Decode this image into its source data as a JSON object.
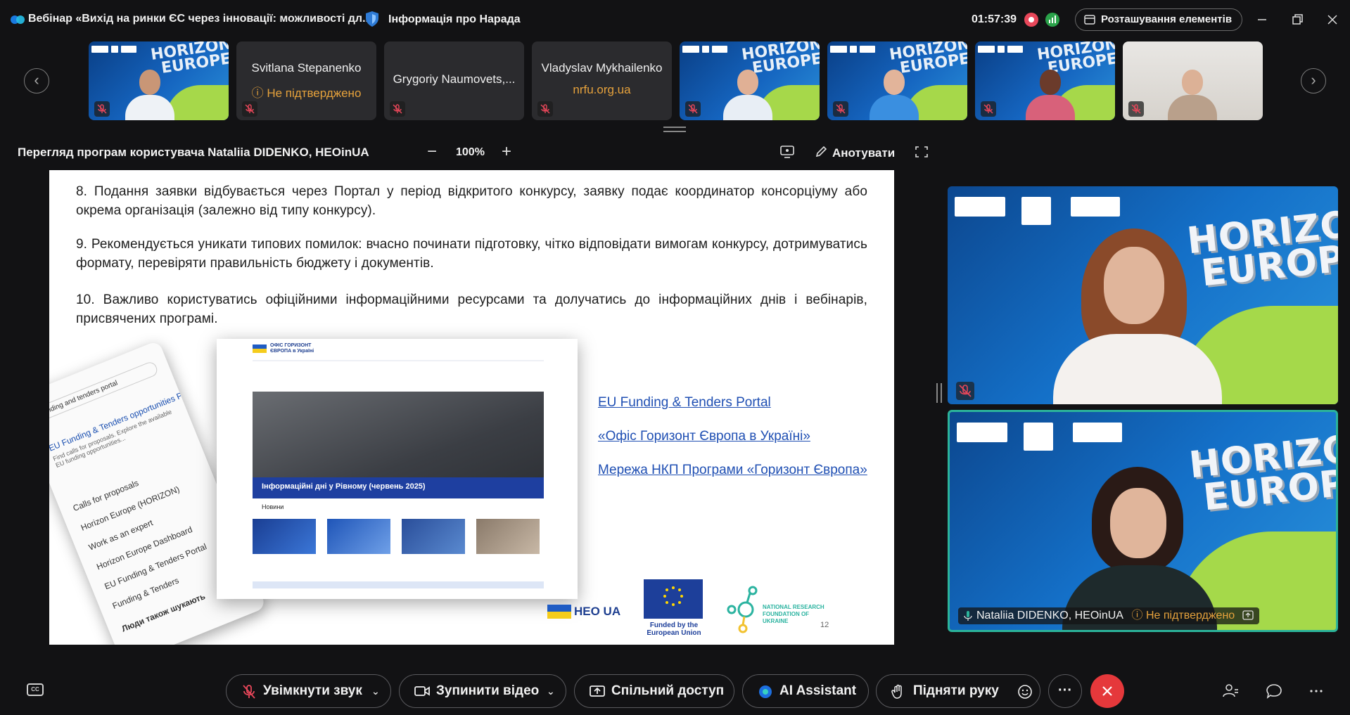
{
  "window": {
    "title": "Вебінар «Вихід на ринки ЄС через інновації: можливості дл...",
    "security_label": "Інформація про Нарада",
    "timer": "01:57:39",
    "layout_button": "Розташування елементів"
  },
  "filmstrip": {
    "tiles": [
      {
        "type": "video"
      },
      {
        "type": "name",
        "name": "Svitlana Stepanenko",
        "sub": "Не підтверджено",
        "sub_icon": "question-circle-icon"
      },
      {
        "type": "name",
        "name": "Grygoriy Naumovets,..."
      },
      {
        "type": "name",
        "name": "Vladyslav Mykhailenko",
        "sub": "nrfu.org.ua"
      },
      {
        "type": "video"
      },
      {
        "type": "video"
      },
      {
        "type": "video"
      },
      {
        "type": "video"
      }
    ]
  },
  "share": {
    "title": "Перегляд програм користувача Nataliia DIDENKO, HEOinUA",
    "zoom": "100%",
    "annotate_label": "Анотувати"
  },
  "slide": {
    "paragraphs": [
      "8. Подання заявки відбувається через Портал у період відкритого конкурсу, заявку подає координатор консорціуму або окрема організація (залежно від типу конкурсу).",
      "9. Рекомендується уникати типових помилок: вчасно починати підготовку, чітко відповідати вимогам конкурсу, дотримуватись формату, перевіряти правильність бюджету і документів.",
      "10. Важливо користуватись офіційними інформаційними ресурсами та долучатись до інформаційних днів і вебінарів, присвячених програмі."
    ],
    "links": [
      "EU Funding & Tenders Portal",
      "«Офіс Горизонт Європа в Україні»",
      "Мережа НКП Програми «Горизонт Європа»"
    ],
    "webpage_banner": "Інформаційні дні у Рівному (червень 2025)",
    "webpage_news": "Новини",
    "webpage_logo": "ОФІС ГОРИЗОНТ ЄВРОПА в Україні",
    "phone_search": "funding and tenders portal",
    "phone_result_title": "EU Funding & Tenders opportunities Portal",
    "phone_items": [
      "Calls for proposals",
      "Horizon Europe (HORIZON)",
      "Work as an expert",
      "Horizon Europe Dashboard",
      "EU Funding & Tenders Portal",
      "Funding & Tenders"
    ],
    "phone_people_also": "Люди також шукають",
    "footer_heo": "HEO UA",
    "footer_eu": "Funded by the European Union",
    "footer_nrfu": "NATIONAL RESEARCH FOUNDATION OF UKRAINE",
    "page_number": "12"
  },
  "videos": {
    "active_name": "Nataliia DIDENKO, HEOinUA",
    "active_status": "Не підтверджено",
    "horizon_text_1": "HORIZON",
    "horizon_text_2": "EUROPE"
  },
  "controls": {
    "unmute": "Увімкнути звук",
    "stop_video": "Зупинити відео",
    "share": "Спільний доступ",
    "ai": "AI Assistant",
    "raise_hand": "Підняти руку",
    "more": "···"
  },
  "colors": {
    "background": "#121214",
    "accent_green": "#2bb39a",
    "warning": "#e6a23c",
    "leave_red": "#e5383b",
    "link_blue": "#1f4fb3"
  }
}
